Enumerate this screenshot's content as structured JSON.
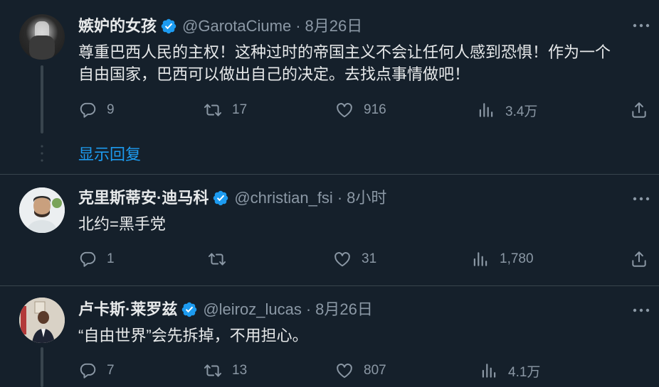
{
  "colors": {
    "background": "#15202b",
    "text": "#e7e9ea",
    "muted": "#8b98a5",
    "accent": "#1d9bf0",
    "divider": "#38444d"
  },
  "tweets": [
    {
      "name": "嫉妒的女孩",
      "handle": "@GarotaCiume",
      "dot": "·",
      "time": "8月26日",
      "text": "尊重巴西人民的主权！这种过时的帝国主义不会让任何人感到恐惧！作为一个\n自由国家，巴西可以做出自己的决定。去找点事情做吧！",
      "replies": "9",
      "retweets": "17",
      "likes": "916",
      "views": "3.4万",
      "show_replies": "显示回复"
    },
    {
      "name": "克里斯蒂安·迪马科",
      "handle": "@christian_fsi",
      "dot": "·",
      "time": "8小时",
      "text": "北约=黑手党",
      "replies": "1",
      "retweets": "",
      "likes": "31",
      "views": "1,780"
    },
    {
      "name": "卢卡斯·莱罗兹",
      "handle": "@leiroz_lucas",
      "dot": "·",
      "time": "8月26日",
      "text": "“自由世界”会先拆掉，不用担心。",
      "replies": "7",
      "retweets": "13",
      "likes": "807",
      "views": "4.1万"
    }
  ],
  "icons": [
    "verified-badge-icon",
    "more-icon",
    "reply-icon",
    "retweet-icon",
    "like-icon",
    "views-icon",
    "share-icon"
  ]
}
